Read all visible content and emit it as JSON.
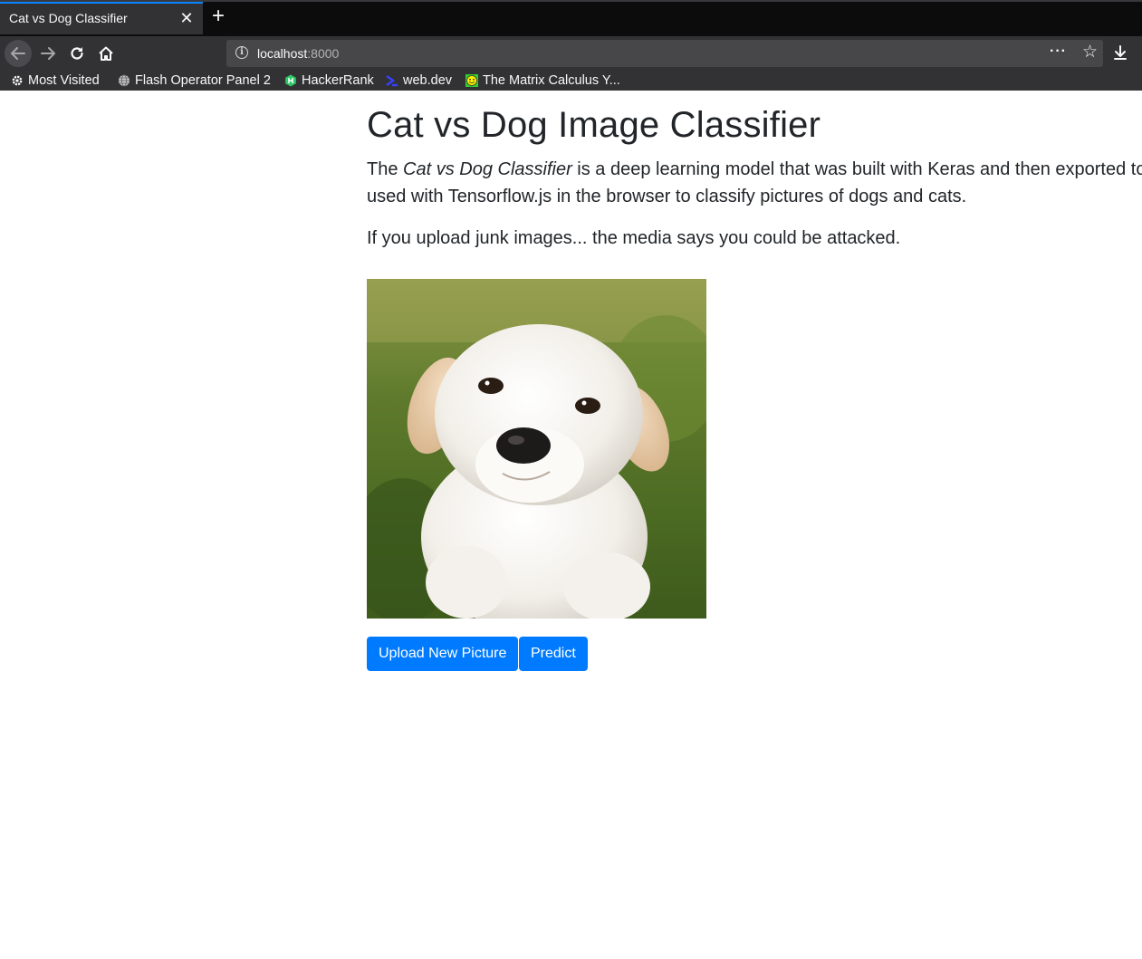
{
  "browser": {
    "tab_title": "Cat vs Dog Classifier",
    "url_host": "localhost",
    "url_port": ":8000",
    "bookmarks": [
      {
        "label": "Most Visited",
        "icon": "gear-icon"
      },
      {
        "label": "Flash Operator Panel 2",
        "icon": "globe-icon"
      },
      {
        "label": "HackerRank",
        "icon": "hackerrank-icon"
      },
      {
        "label": "web.dev",
        "icon": "webdev-icon"
      },
      {
        "label": "The Matrix Calculus Y...",
        "icon": "smiley-icon"
      }
    ]
  },
  "page": {
    "title": "Cat vs Dog Image Classifier",
    "intro_before": "The ",
    "intro_em": "Cat vs Dog Classifier",
    "intro_after": " is a deep learning model that was built with Keras and then exported to be used with Tensorflow.js in the browser to classify pictures of dogs and cats.",
    "warning": "If you upload junk images... the media says you could be attacked.",
    "image_subject": "white puppy sitting on grass",
    "upload_label": "Upload New Picture",
    "predict_label": "Predict",
    "accent_color": "#007bff"
  }
}
